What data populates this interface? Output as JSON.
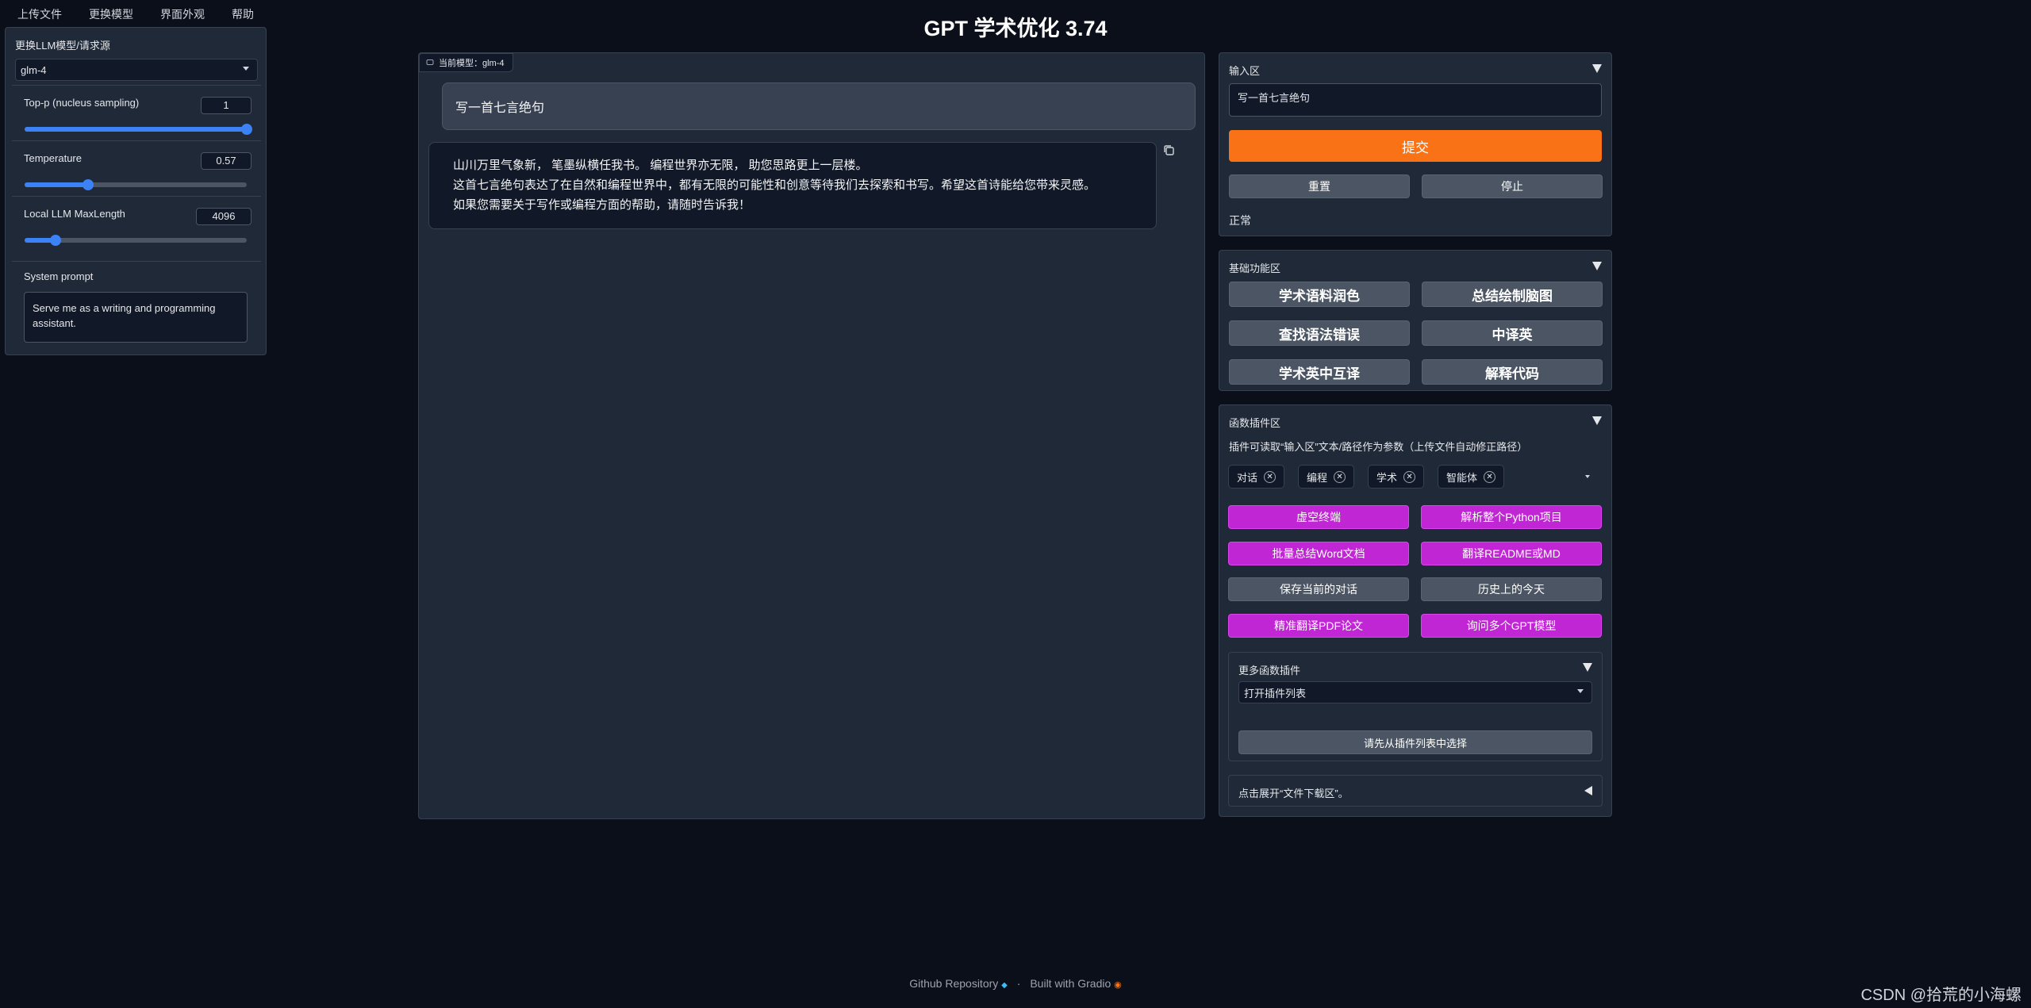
{
  "menu": [
    "上传文件",
    "更换模型",
    "界面外观",
    "帮助"
  ],
  "title": "GPT 学术优化 3.74",
  "left_panel": {
    "model_label": "更换LLM模型/请求源",
    "model_value": "glm-4",
    "top_p": {
      "label": "Top-p (nucleus sampling)",
      "value": "1",
      "fraction": 1.0
    },
    "temperature": {
      "label": "Temperature",
      "value": "0.57",
      "fraction": 0.285
    },
    "max_length": {
      "label": "Local LLM MaxLength",
      "value": "4096",
      "fraction": 0.14
    },
    "system_prompt": {
      "label": "System prompt",
      "value": "Serve me as a writing and programming assistant."
    }
  },
  "chat": {
    "model_tag": "当前模型：glm-4",
    "user_message": "写一首七言绝句",
    "bot_lines": [
      "山川万里气象新， 笔墨纵横任我书。 编程世界亦无限， 助您思路更上一层楼。",
      "这首七言绝句表达了在自然和编程世界中，都有无限的可能性和创意等待我们去探索和书写。希望这首诗能给您带来灵感。",
      "如果您需要关于写作或编程方面的帮助，请随时告诉我！"
    ]
  },
  "input_area": {
    "title": "输入区",
    "value": "写一首七言绝句",
    "submit": "提交",
    "reset": "重置",
    "stop": "停止",
    "status": "正常"
  },
  "basic": {
    "title": "基础功能区",
    "buttons": [
      "学术语料润色",
      "总结绘制脑图",
      "查找语法错误",
      "中译英",
      "学术英中互译",
      "解释代码"
    ]
  },
  "plugins": {
    "title": "函数插件区",
    "hint": "插件可读取“输入区”文本/路径作为参数（上传文件自动修正路径）",
    "tags": [
      "对话",
      "编程",
      "学术",
      "智能体"
    ],
    "buttons": [
      "虚空终端",
      "解析整个Python项目",
      "批量总结Word文档",
      "翻译README或MD",
      "保存当前的对话",
      "历史上的今天",
      "精准翻译PDF论文",
      "询问多个GPT模型"
    ],
    "more_title": "更多函数插件",
    "more_select": "打开插件列表",
    "more_button": "请先从插件列表中选择",
    "download": "点击展开“文件下载区”。"
  },
  "footer": {
    "github": "Github Repository",
    "sep": "·",
    "gradio": "Built with Gradio"
  },
  "watermark": "CSDN @拾荒的小海螺",
  "colors": {
    "accent_blue": "#3b82f6",
    "submit_orange": "#f97316",
    "plugin_magenta": "#c026d3",
    "panel": "#1f2937",
    "background": "#0b0f19"
  }
}
